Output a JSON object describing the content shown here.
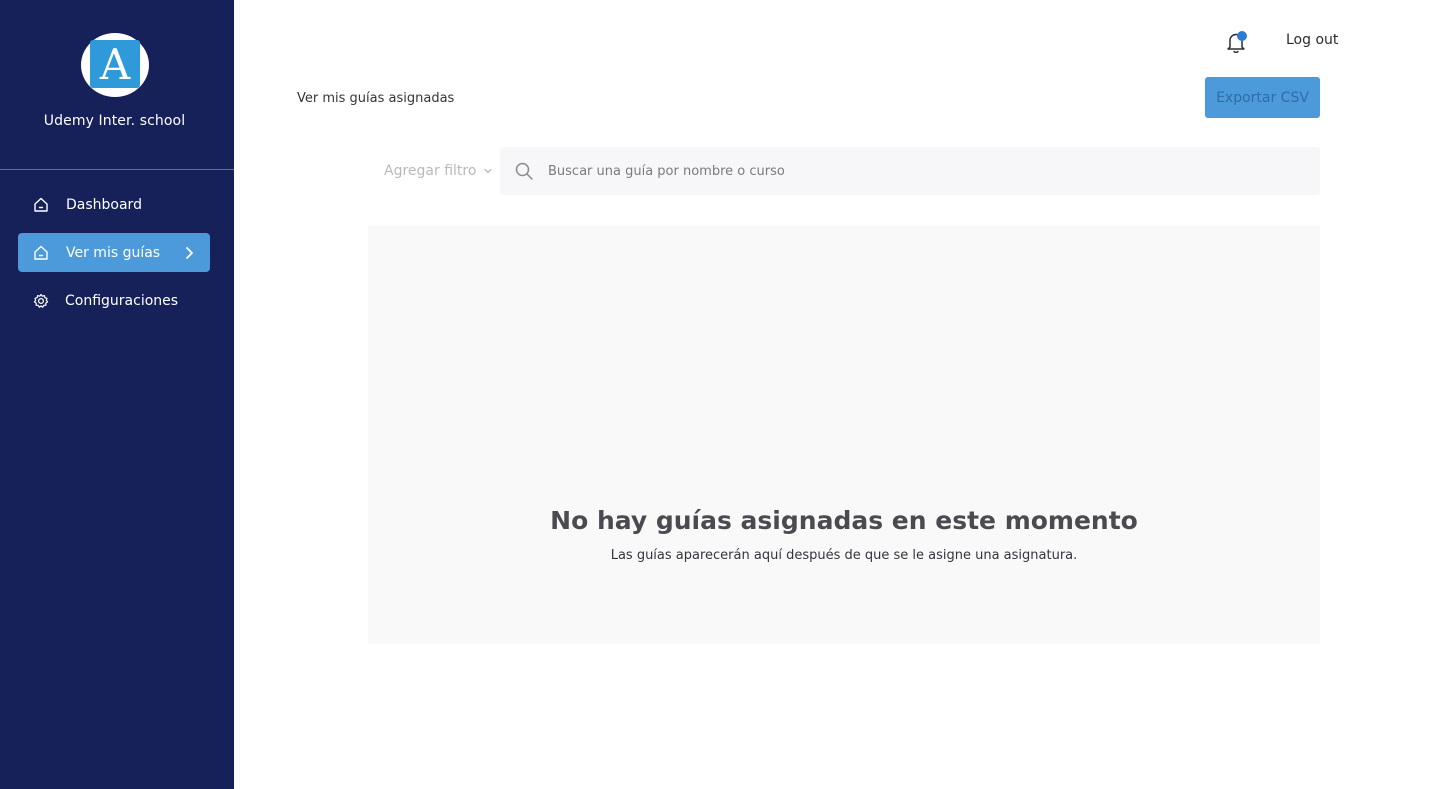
{
  "sidebar": {
    "logo_letter": "A",
    "brand_name": "Udemy Inter. school",
    "items": [
      {
        "label": "Dashboard",
        "icon": "home-icon",
        "active": false
      },
      {
        "label": "Ver mis guías",
        "icon": "home-icon",
        "active": true
      },
      {
        "label": "Configuraciones",
        "icon": "gear-icon",
        "active": false
      }
    ]
  },
  "topbar": {
    "logout_label": "Log out",
    "bell_icon": "bell-icon",
    "has_notification": true
  },
  "header": {
    "title": "Ver mis guías asignadas",
    "export_label": "Exportar CSV"
  },
  "filters": {
    "filter_label": "Agregar filtro",
    "search_placeholder": "Buscar una guía por nombre o curso",
    "search_value": ""
  },
  "empty_state": {
    "title": "No hay guías asignadas en este momento",
    "subtitle": "Las guías aparecerán aquí después de que se le asigne una asignatura."
  },
  "colors": {
    "sidebar_bg": "#16215a",
    "accent": "#4c9ad9",
    "logo_blue": "#2e9ad9",
    "notification_dot": "#2e7bd4",
    "panel_bg": "#faf9fa"
  }
}
